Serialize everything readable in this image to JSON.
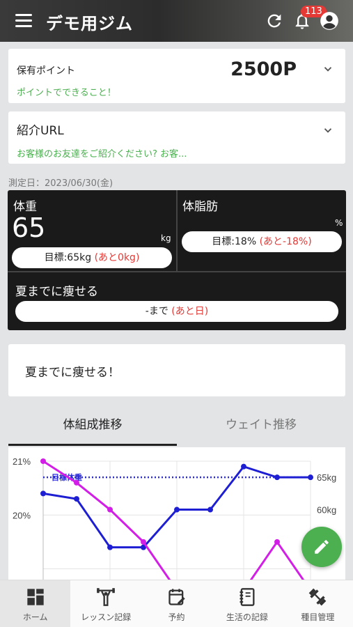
{
  "header": {
    "title": "デモ用ジム",
    "notification_count": "113"
  },
  "points": {
    "label": "保有ポイント",
    "value": "2500P",
    "link": "ポイントでできること！"
  },
  "referral": {
    "label": "紹介URL",
    "link": "お客様のお友達をご紹介ください? お客..."
  },
  "measurement": {
    "date_label": "測定日：2023/06/30(金)"
  },
  "weight": {
    "label": "体重",
    "value": "65",
    "unit": "kg",
    "goal_prefix": "目標:65kg",
    "goal_remaining": "(あと0kg)"
  },
  "body_fat": {
    "label": "体脂肪",
    "value": "",
    "unit": "%",
    "goal_prefix": "目標:18%",
    "goal_remaining": "(あと-18%)"
  },
  "goal_deadline": {
    "label": "夏までに痩せる",
    "until": "-まで",
    "remaining": "(あと日)"
  },
  "goal_text": "夏までに痩せる！",
  "tabs": [
    {
      "label": "体組成推移",
      "active": true
    },
    {
      "label": "ウェイト推移",
      "active": false
    }
  ],
  "chart_data": {
    "type": "line",
    "left_axis_ticks": [
      "21%",
      "20%"
    ],
    "right_axis_ticks": [
      "65kg",
      "60kg"
    ],
    "target_label": "目標体重",
    "series": [
      {
        "color": "#1e1ed2",
        "values": [
          20.4,
          20.3,
          19.4,
          19.4,
          20.1,
          20.1,
          20.9,
          20.7,
          20.7
        ]
      },
      {
        "color": "#d21ee6",
        "values": [
          21.0,
          20.6,
          20.1,
          19.5,
          18.6,
          18.6,
          18.6,
          19.5,
          18.6
        ]
      }
    ],
    "target_value": 20.7,
    "ylim": [
      18.8,
      21.0
    ],
    "grid": true
  },
  "nav": [
    {
      "label": "ホーム",
      "icon": "home-grid-icon",
      "active": true
    },
    {
      "label": "レッスン記録",
      "icon": "weightlifter-icon",
      "active": false
    },
    {
      "label": "予約",
      "icon": "calendar-edit-icon",
      "active": false
    },
    {
      "label": "生活の記録",
      "icon": "notebook-icon",
      "active": false
    },
    {
      "label": "種目管理",
      "icon": "dumbbell-icon",
      "active": false
    }
  ],
  "colors": {
    "accent_green": "#4caf50",
    "alert_red": "#e53935",
    "dark_panel": "#1a1a1a"
  }
}
